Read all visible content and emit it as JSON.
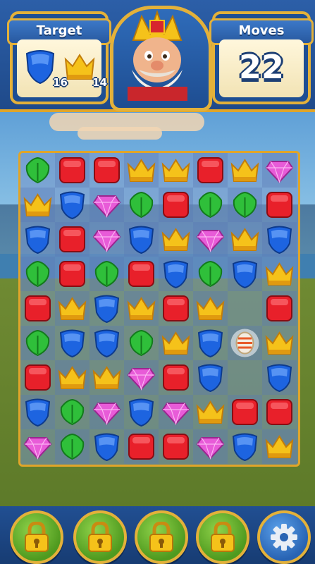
{
  "header": {
    "target_label": "Target",
    "moves_label": "Moves",
    "moves_value": "22",
    "targets": [
      {
        "icon": "blue-shield-icon",
        "count": "16"
      },
      {
        "icon": "yellow-crown-icon",
        "count": "14"
      }
    ]
  },
  "board": {
    "rows": [
      [
        "leaf",
        "red",
        "red",
        "crown",
        "crown",
        "red",
        "crown",
        "gem"
      ],
      [
        "crown",
        "shield",
        "gem",
        "leaf",
        "red",
        "leaf",
        "leaf",
        "red"
      ],
      [
        "shield",
        "red",
        "gem",
        "shield",
        "crown",
        "gem",
        "crown",
        "shield"
      ],
      [
        "leaf",
        "red",
        "leaf",
        "red",
        "shield",
        "leaf",
        "shield",
        "crown"
      ],
      [
        "red",
        "crown",
        "shield",
        "crown",
        "red",
        "crown",
        "",
        "red"
      ],
      [
        "leaf",
        "shield",
        "shield",
        "leaf",
        "crown",
        "shield",
        "rocket",
        "crown"
      ],
      [
        "red",
        "crown",
        "crown",
        "gem",
        "red",
        "shield",
        "",
        "shield"
      ],
      [
        "shield",
        "leaf",
        "gem",
        "shield",
        "gem",
        "crown",
        "red",
        "red"
      ],
      [
        "gem",
        "leaf",
        "shield",
        "red",
        "red",
        "gem",
        "shield",
        "crown"
      ]
    ]
  },
  "colors": {
    "red": "#e8202a",
    "shield": "#1d64e0",
    "crown": "#f5c21a",
    "leaf": "#2fbf3a",
    "gem": "#e85bd8",
    "accent_gold": "#e3b13a"
  },
  "footer": {
    "boosters": [
      "lock-icon",
      "lock-icon",
      "lock-icon",
      "lock-icon"
    ],
    "settings_icon": "gear-icon"
  }
}
